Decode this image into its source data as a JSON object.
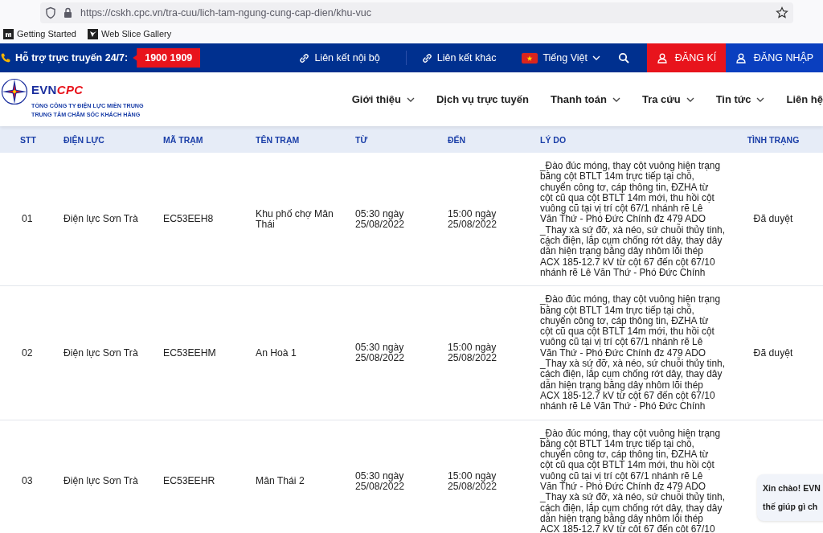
{
  "browser": {
    "url": "https://cskh.cpc.vn/tra-cuu/lich-tam-ngung-cung-cap-dien/khu-vuc",
    "bookmarks": [
      "Getting Started",
      "Web Slice Gallery"
    ]
  },
  "top_bar": {
    "hotline_label": "Hỗ trợ trực truyến 24/7:",
    "hotline_number": "1900 1909",
    "links": [
      "Liên kết nội bộ",
      "Liên kết khác"
    ],
    "language": "Tiếng Việt",
    "register": "ĐĂNG KÍ",
    "login": "ĐĂNG NHẬP"
  },
  "header": {
    "logo": {
      "brand_main": "EVN",
      "brand_accent": "CPC",
      "line_1": "TỔNG CÔNG TY ĐIỆN LỰC MIỀN TRUNG",
      "line_2": "TRUNG TÂM CHĂM SÓC KHÁCH HÀNG"
    },
    "nav": [
      {
        "label": "Giới thiệu",
        "has_menu": true
      },
      {
        "label": "Dịch vụ trực tuyến",
        "has_menu": false
      },
      {
        "label": "Thanh toán",
        "has_menu": true
      },
      {
        "label": "Tra cứu",
        "has_menu": true
      },
      {
        "label": "Tin tức",
        "has_menu": true
      },
      {
        "label": "Liên hệ",
        "has_menu": false
      }
    ]
  },
  "table": {
    "columns": [
      "STT",
      "ĐIỆN LỰC",
      "MÃ TRẠM",
      "TÊN TRẠM",
      "TỪ",
      "ĐẾN",
      "LÝ DO",
      "TÌNH TRẠNG"
    ],
    "rows": [
      {
        "stt": "01",
        "unit": "Điện lực Sơn Trà",
        "station_code": "EC53EEH8",
        "station_name": "Khu phố chợ Mân Thái",
        "from": "05:30 ngày 25/08/2022",
        "to": "15:00 ngày 25/08/2022",
        "reason": "_Đào đúc móng, thay cột vuông hiện trạng\nbằng cột BTLT 14m trực tiếp tại chỗ,\nchuyển công tơ, cáp thông tin, ĐZHA từ\ncột cũ qua cột BTLT 14m mới, thu hồi cột\nvuông cũ tại vị trí cột 67/1 nhánh rẽ Lê\nVăn Thứ - Phó Đức Chính đz 479 ADO\n_Thay xà sứ đỡ, xà néo, sứ chuỗi thủy tinh,\ncách điện, lắp cụm chống rớt dây, thay dây\ndẫn hiện trạng bằng dây nhôm lõi thép\nACX 185-12.7 kV từ cột 67 đến cột 67/10\nnhánh rẽ Lê Văn Thứ - Phó Đức Chính",
        "status": "Đã duyệt"
      },
      {
        "stt": "02",
        "unit": "Điện lực Sơn Trà",
        "station_code": "EC53EEHM",
        "station_name": "An Hoà 1",
        "from": "05:30 ngày 25/08/2022",
        "to": "15:00 ngày 25/08/2022",
        "reason": "_Đào đúc móng, thay cột vuông hiện trạng\nbằng cột BTLT 14m trực tiếp tại chỗ,\nchuyển công tơ, cáp thông tin, ĐZHA từ\ncột cũ qua cột BTLT 14m mới, thu hồi cột\nvuông cũ tại vị trí cột 67/1 nhánh rẽ Lê\nVăn Thứ - Phó Đức Chính đz 479 ADO\n_Thay xà sứ đỡ, xà néo, sứ chuỗi thủy tinh,\ncách điện, lắp cụm chống rớt dây, thay dây\ndẫn hiện trạng bằng dây nhôm lõi thép\nACX 185-12.7 kV từ cột 67 đến cột 67/10\nnhánh rẽ Lê Văn Thứ - Phó Đức Chính",
        "status": "Đã duyệt"
      },
      {
        "stt": "03",
        "unit": "Điện lực Sơn Trà",
        "station_code": "EC53EEHR",
        "station_name": "Mân Thái 2",
        "from": "05:30 ngày 25/08/2022",
        "to": "15:00 ngày 25/08/2022",
        "reason": "_Đào đúc móng, thay cột vuông hiện trạng\nbằng cột BTLT 14m trực tiếp tại chỗ,\nchuyển công tơ, cáp thông tin, ĐZHA từ\ncột cũ qua cột BTLT 14m mới, thu hồi cột\nvuông cũ tại vị trí cột 67/1 nhánh rẽ Lê\nVăn Thứ - Phó Đức Chính đz 479 ADO\n_Thay xà sứ đỡ, xà néo, sứ chuỗi thủy tinh,\ncách điện, lắp cụm chống rớt dây, thay dây\ndẫn hiện trạng bằng dây nhôm lõi thép\nACX 185-12.7 kV từ cột 67 đến cột 67/10"
      }
    ]
  },
  "chat_bubble": {
    "lines": [
      "Xin chào! EVN",
      "thế giúp gì ch"
    ]
  }
}
